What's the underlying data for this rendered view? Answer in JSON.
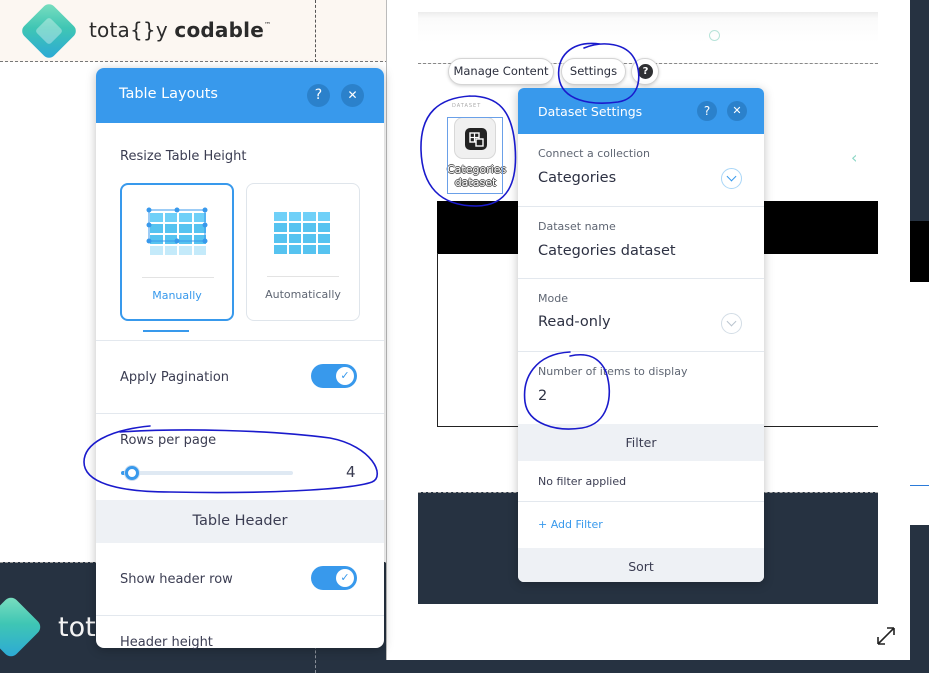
{
  "site": {
    "logo_text_pre": "tota{}y ",
    "logo_text_bold": "codable",
    "logo_tm": "™",
    "footer_text": "tot"
  },
  "editor_toolbar": {
    "manage_content": "Manage Content",
    "settings": "Settings",
    "help": "?"
  },
  "dataset_chip": {
    "tag": "DATASET",
    "label_line1": "Categories",
    "label_line2": "dataset",
    "icon": "dataset-table-icon"
  },
  "table_layouts": {
    "title": "Table Layouts",
    "help": "?",
    "close": "✕",
    "resize_label": "Resize Table Height",
    "option_manual": "Manually",
    "option_auto": "Automatically",
    "selected_option": "Manually",
    "pagination_label": "Apply Pagination",
    "pagination_on": true,
    "rows_per_page_label": "Rows per page",
    "rows_per_page_value": "4",
    "rows_per_page_fraction": 0.05,
    "table_header_section": "Table Header",
    "show_header_label": "Show header row",
    "show_header_on": true,
    "header_height_label": "Header height"
  },
  "dataset_settings": {
    "title": "Dataset Settings",
    "help": "?",
    "close": "✕",
    "collection_label": "Connect a collection",
    "collection_value": "Categories",
    "name_label": "Dataset name",
    "name_value": "Categories dataset",
    "mode_label": "Mode",
    "mode_value": "Read-only",
    "items_label": "Number of items to display",
    "items_value": "2",
    "filter_section": "Filter",
    "no_filter": "No filter applied",
    "add_filter": "+ Add Filter",
    "sort_section": "Sort"
  },
  "colors": {
    "accent": "#3899ec",
    "header_dark": "#2b81cb",
    "site_dark": "#263241",
    "annotation": "#1a1acc"
  }
}
